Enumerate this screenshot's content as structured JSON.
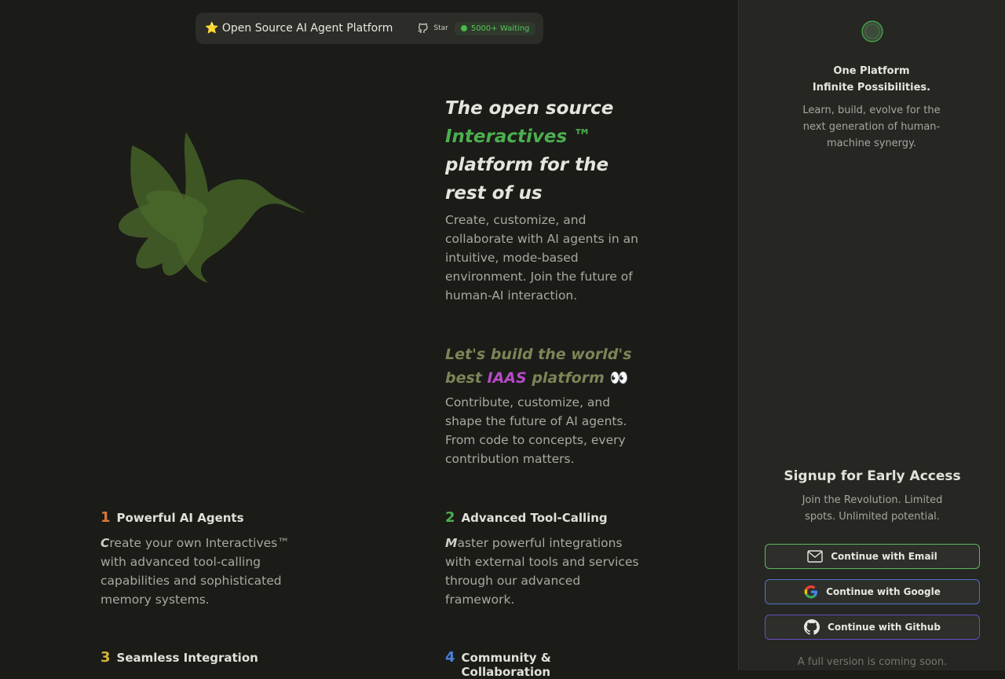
{
  "topbar": {
    "star_emoji": "⭐",
    "title": "Open Source AI Agent Platform",
    "star_label": "Star",
    "waiting_badge": "5000+ Waiting"
  },
  "hero": {
    "line1": "The open source",
    "highlight": "Interactives ™",
    "line3": "platform for the",
    "line4": "rest of us",
    "description": "Create, customize, and collaborate with AI agents in an intuitive, mode-based environment. Join the future of human-AI interaction."
  },
  "build": {
    "part1": "Let's build the world's",
    "part2": "best",
    "highlight": "IAAS",
    "part3": "platform",
    "eyes": "👀",
    "description": "Contribute, customize, and shape the future of AI agents. From code to concepts, every contribution matters."
  },
  "features": [
    {
      "num": "1",
      "title": "Powerful AI Agents",
      "first": "C",
      "rest": "reate your own Interactives™ with advanced tool-calling capabilities and sophisticated memory systems.",
      "color": "#d9783b"
    },
    {
      "num": "2",
      "title": "Advanced Tool-Calling",
      "first": "M",
      "rest": "aster powerful integrations with external tools and services through our advanced framework.",
      "color": "#4caf4f"
    },
    {
      "num": "3",
      "title": "Seamless Integration",
      "color": "#d6b534"
    },
    {
      "num": "4",
      "title": "Community & Collaboration",
      "color": "#4a7fd6"
    }
  ],
  "side": {
    "heading_line1": "One Platform",
    "heading_line2": "Infinite Possibilities.",
    "tagline": "Learn, build, evolve for the next generation of human-machine synergy.",
    "signup_title": "Signup for Early Access",
    "signup_sub": "Join the Revolution. Limited spots. Unlimited potential.",
    "email_btn": "Continue with Email",
    "google_btn": "Continue with Google",
    "github_btn": "Continue with Github",
    "coming_soon": "A full version is coming soon."
  },
  "colors": {
    "accent_green": "#4caf4f",
    "accent_purple": "#b64bc8",
    "background": "#1b1b18",
    "sidebar": "#262623"
  },
  "icons": [
    "star-icon",
    "github-icon",
    "status-dot-icon",
    "hummingbird-logo",
    "app-logo-icon",
    "mail-icon",
    "google-icon",
    "github-icon"
  ]
}
